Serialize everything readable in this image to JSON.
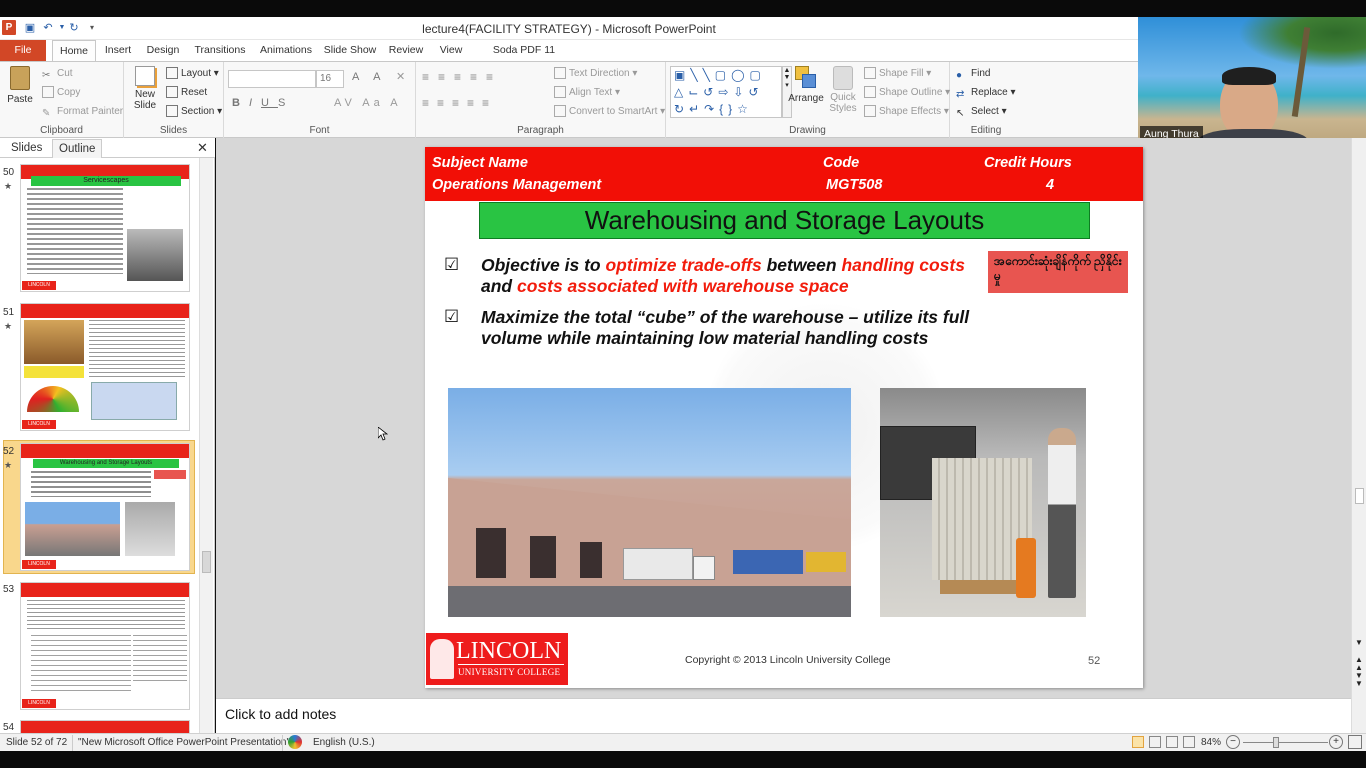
{
  "window": {
    "title": "lecture4(FACILITY STRATEGY)  -  Microsoft PowerPoint"
  },
  "tabs": [
    {
      "label": "File"
    },
    {
      "label": "Home"
    },
    {
      "label": "Insert"
    },
    {
      "label": "Design"
    },
    {
      "label": "Transitions"
    },
    {
      "label": "Animations"
    },
    {
      "label": "Slide Show"
    },
    {
      "label": "Review"
    },
    {
      "label": "View"
    },
    {
      "label": "Soda PDF 11 Creator"
    }
  ],
  "ribbon": {
    "clipboard": {
      "label": "Clipboard",
      "paste": "Paste",
      "cut": "Cut",
      "copy": "Copy",
      "format_painter": "Format Painter"
    },
    "slides": {
      "label": "Slides",
      "new_slide": "New",
      "new_slide2": "Slide",
      "layout": "Layout",
      "reset": "Reset",
      "section": "Section"
    },
    "font": {
      "label": "Font",
      "size": "16"
    },
    "paragraph": {
      "label": "Paragraph",
      "text_direction": "Text Direction",
      "align_text": "Align Text",
      "convert_smartart": "Convert to SmartArt"
    },
    "drawing": {
      "label": "Drawing",
      "arrange": "Arrange",
      "quick_styles": "Quick",
      "quick_styles2": "Styles",
      "shape_fill": "Shape Fill",
      "shape_outline": "Shape Outline",
      "shape_effects": "Shape Effects"
    },
    "editing": {
      "label": "Editing",
      "find": "Find",
      "replace": "Replace",
      "select": "Select"
    }
  },
  "webcam": {
    "name": "Aung Thura"
  },
  "panel": {
    "tab_slides": "Slides",
    "tab_outline": "Outline"
  },
  "thumbnails": [
    {
      "num": "50",
      "title": "Servicescapes"
    },
    {
      "num": "51",
      "title": ""
    },
    {
      "num": "52",
      "title": "Warehousing and Storage Layouts"
    },
    {
      "num": "53",
      "title": ""
    },
    {
      "num": "54",
      "title": ""
    }
  ],
  "slide": {
    "subject_label": "Subject Name",
    "subject_value": "Operations Management",
    "code_label": "Code",
    "code_value": "MGT508",
    "credit_label": "Credit Hours",
    "credit_value": "4",
    "title": "Warehousing and Storage Layouts",
    "bullet1": {
      "a": "Objective is to ",
      "b": "optimize trade-offs",
      "c": " between ",
      "d": "handling costs",
      "e": " and ",
      "f": "costs associated with warehouse space"
    },
    "bullet2": "Maximize the total “cube” of the warehouse – utilize its full volume while maintaining low material handling costs",
    "myanmar_note": "အကောင်းဆုံးချိန်ကိုက် ညှိနိုင်းမှု",
    "logo_main": "LINCOLN",
    "logo_sub": "UNIVERSITY COLLEGE",
    "copyright": "Copyright © 2013 Lincoln University College",
    "number": "52"
  },
  "notes": {
    "placeholder": "Click to add notes"
  },
  "status": {
    "slide": "Slide 52 of 72",
    "theme": "\"New Microsoft Office PowerPoint Presentation\"",
    "language": "English (U.S.)",
    "zoom": "84%"
  },
  "colors": {
    "header_red": "#f20f06",
    "title_green": "#29c443",
    "accent_orange": "#d24726"
  }
}
